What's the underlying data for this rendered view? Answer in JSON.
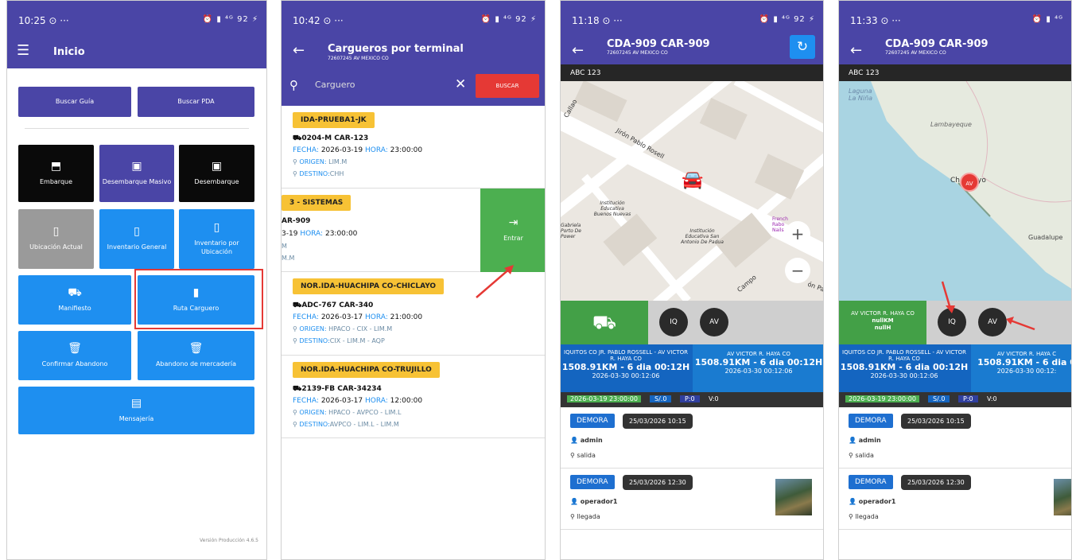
{
  "screen1": {
    "time": "10:25",
    "status_icons": "⏰ ▮ ⁴ᴳ 92 ⚡",
    "title": "Inicio",
    "buttons": {
      "buscar_guia": "Buscar Guía",
      "buscar_pda": "Buscar PDA",
      "embarque": "Embarque",
      "desembarque_masivo": "Desembarque Masivo",
      "desembarque": "Desembarque",
      "ubicacion_actual": "Ubicación Actual",
      "inventario_general": "Inventario General",
      "inventario_ubicacion": "Inventario por Ubicación",
      "manifiesto": "Manifiesto",
      "ruta_carguero": "Ruta Carguero",
      "confirmar_abandono": "Confirmar Abandono",
      "abandono_mercaderia": "Abandono de mercadería",
      "mensajeria": "Mensajería"
    },
    "version": "Versión Producción 4.6.5"
  },
  "screen2": {
    "time": "10:42",
    "status_icons": "⏰ ▮ ⁴ᴳ 92 ⚡",
    "title": "Cargueros por terminal",
    "subtitle": "72607245 AV MEXICO CO",
    "search_value": "Carguero",
    "search_button": "BUSCAR",
    "entrar": "Entrar",
    "cards": [
      {
        "tag": "IDA-PRUEBA1-JK",
        "vehicle": "0204-M CAR-123",
        "fecha_label": "FECHA:",
        "fecha": "2026-03-19",
        "hora_label": "HORA:",
        "hora": "23:00:00",
        "origen_label": "ORIGEN:",
        "origen": "LIM.M",
        "destino_label": "DESTINO:",
        "destino": "CHH"
      },
      {
        "tag": "3 - SISTEMAS",
        "vehicle": "AR-909",
        "fecha": "3-19",
        "hora_label": "HORA:",
        "hora": "23:00:00",
        "origen": "M",
        "destino": "M.M"
      },
      {
        "tag": "NOR.IDA-HUACHIPA CO-CHICLAYO",
        "vehicle": "ADC-767 CAR-340",
        "fecha_label": "FECHA:",
        "fecha": "2026-03-17",
        "hora_label": "HORA:",
        "hora": "21:00:00",
        "origen_label": "ORIGEN:",
        "origen": "HPACO - CIX - LIM.M",
        "destino_label": "DESTINO:",
        "destino": "CIX - LIM.M - AQP"
      },
      {
        "tag": "NOR.IDA-HUACHIPA CO-TRUJILLO",
        "vehicle": "2139-FB CAR-34234",
        "fecha_label": "FECHA:",
        "fecha": "2026-03-17",
        "hora_label": "HORA:",
        "hora": "12:00:00",
        "origen_label": "ORIGEN:",
        "origen": "HPACO - AVPCO - LIM.L",
        "destino_label": "DESTINO:",
        "destino": "AVPCO - LIM.L - LIM.M"
      }
    ]
  },
  "screen3": {
    "time": "11:18",
    "status_icons": "⏰ ▮ ⁴ᴳ 92 ⚡",
    "title": "CDA-909 CAR-909",
    "subtitle": "72607245 AV MEXICO CO",
    "plate": "ABC 123",
    "map_labels": {
      "street1": "Jirón Pablo Rosell",
      "street2": "Callao",
      "school": "Institución Educativa Buenos Nuevas",
      "gabriela": "Gabriela Porto De Power",
      "school2": "Institución Educativa San Antonio De Padua",
      "french": "French Rabo Nails",
      "campo": "Campo",
      "pab": "ón Pab"
    },
    "iq": "IQ",
    "av": "AV",
    "left_addr": "IQUITOS CO JR. PABLO ROSSELL - AV VICTOR R. HAYA CO",
    "left_dist": "1508.91KM - 6 dia 00:12H",
    "left_date": "2026-03-30 00:12:06",
    "right_addr": "AV VICTOR R. HAYA CO",
    "right_dist": "1508.91KM - 6 dia 00:12H",
    "right_date": "2026-03-30 00:12:06",
    "date": "2026-03-19 23:00:00",
    "s": "S/.0",
    "p": "P:0",
    "v": "V:0",
    "events": [
      {
        "chip": "DEMORA",
        "time": "25/03/2026 10:15",
        "user": "admin",
        "place": "salida"
      },
      {
        "chip": "DEMORA",
        "time": "25/03/2026 12:30",
        "user": "operador1",
        "place": "llegada"
      }
    ]
  },
  "screen4": {
    "time": "11:33",
    "status_icons": "⏰ ▮ ⁴ᴳ",
    "title": "CDA-909 CAR-909",
    "subtitle": "72607245 AV MEXICO CO",
    "plate": "ABC 123",
    "map_labels": {
      "laguna": "Laguna La Niña",
      "lambayeque": "Lambayeque",
      "chiclayo": "Ch",
      "chiclayo_end": "yo",
      "guadalupe": "Guadalupe",
      "marker": "AV"
    },
    "green_addr": "AV VICTOR R. HAYA CO",
    "green_km": "nullKM",
    "green_h": "nullH",
    "iq": "IQ",
    "av": "AV",
    "left_addr": "IQUITOS CO JR. PABLO ROSSELL - AV VICTOR R. HAYA CO",
    "left_dist": "1508.91KM - 6 dia 00:12H",
    "left_date": "2026-03-30 00:12:06",
    "right_addr": "AV VICTOR R. HAYA C",
    "right_dist": "1508.91KM - 6 dia 0",
    "right_date": "2026-03-30 00:12:",
    "date": "2026-03-19 23:00:00",
    "s": "S/.0",
    "p": "P:0",
    "v": "V:0",
    "events": [
      {
        "chip": "DEMORA",
        "time": "25/03/2026 10:15",
        "user": "admin",
        "place": "salida"
      },
      {
        "chip": "DEMORA",
        "time": "25/03/2026 12:30",
        "user": "operador1",
        "place": "llegada"
      }
    ]
  }
}
